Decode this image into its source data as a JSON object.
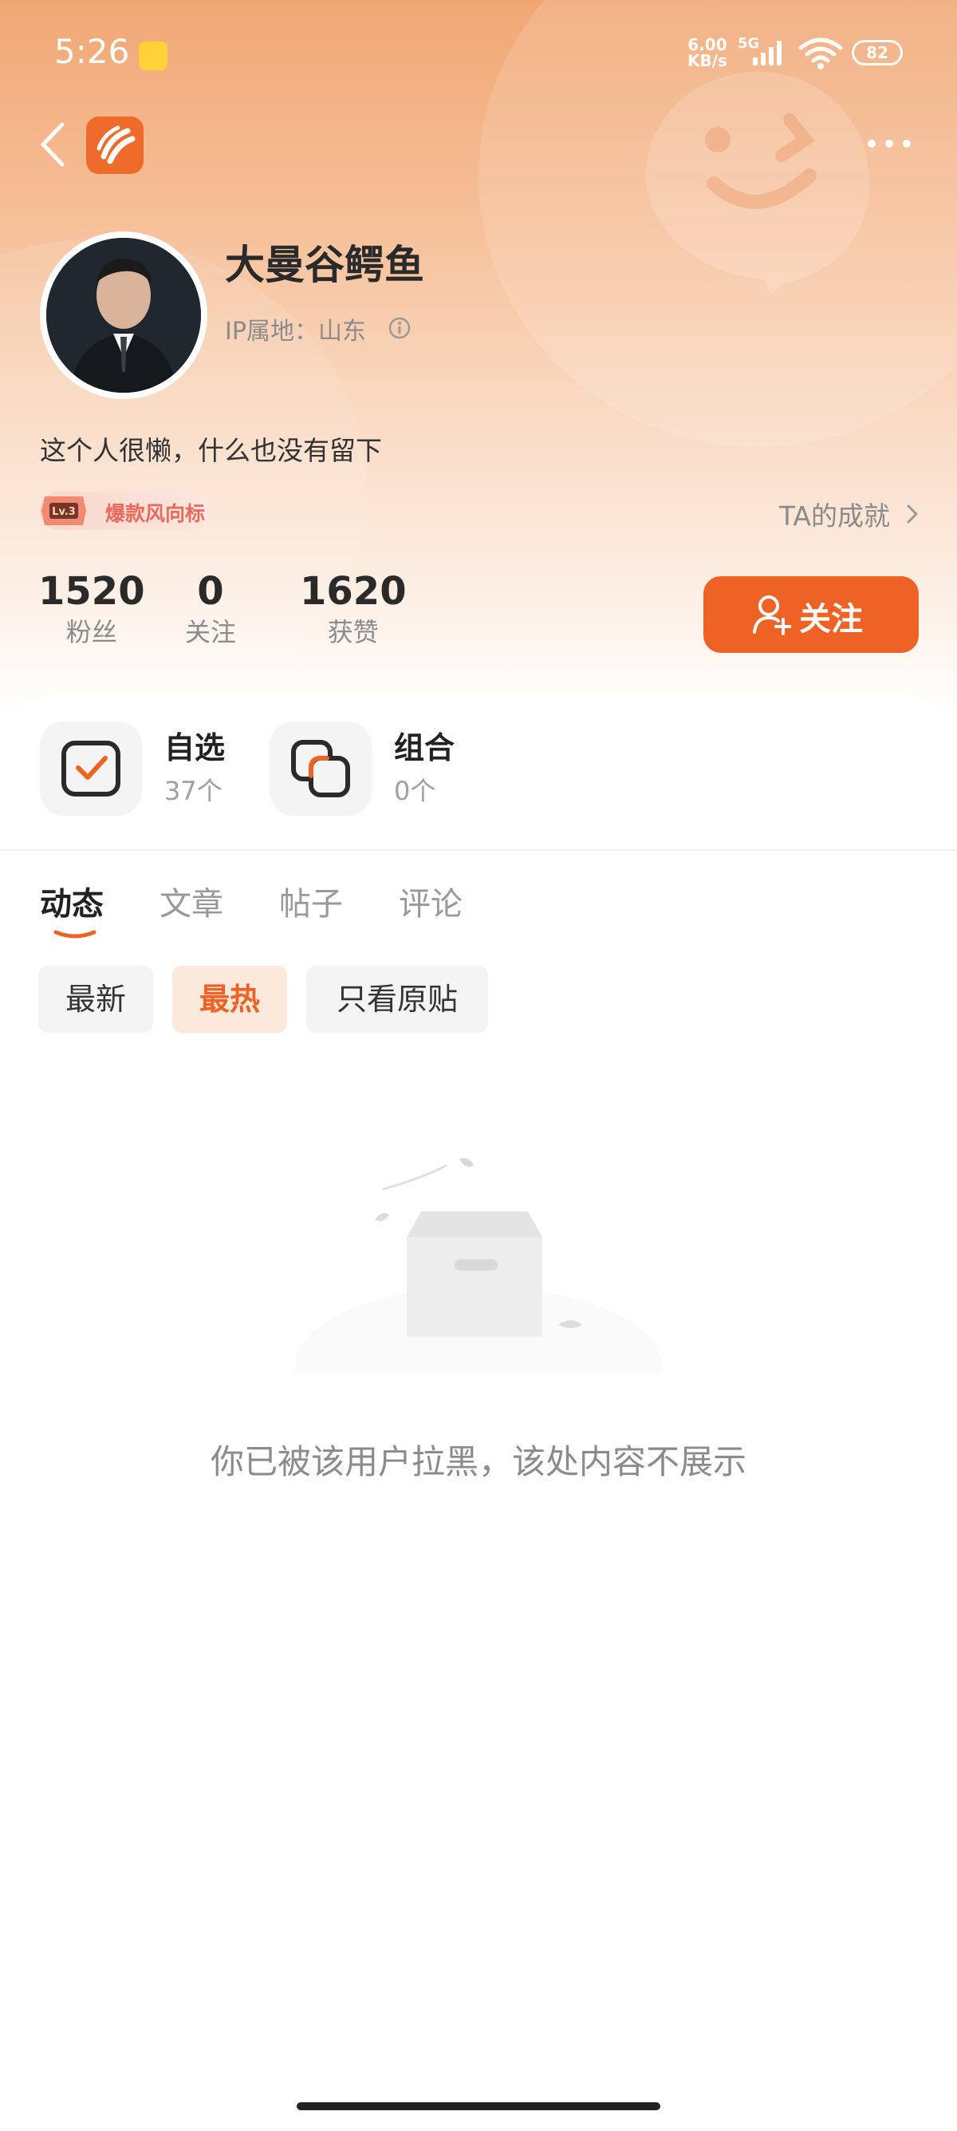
{
  "status_bar": {
    "time": "5:26",
    "net_speed_top": "6.00",
    "net_speed_bottom": "KB/s",
    "network_type": "5G",
    "battery": "82"
  },
  "header": {
    "back_icon": "chevron-left-icon",
    "app_icon": "app-logo-icon",
    "more_icon": "more-dots-icon"
  },
  "profile": {
    "name": "大曼谷鳄鱼",
    "ip_location": "IP属地：山东",
    "bio": "这个人很懒，什么也没有留下",
    "badge_text": "爆款风向标",
    "badge_level": "Lv.3",
    "achievements_link": "TA的成就"
  },
  "stats": [
    {
      "value": "1520",
      "label": "粉丝"
    },
    {
      "value": "0",
      "label": "关注"
    },
    {
      "value": "1620",
      "label": "获赞"
    }
  ],
  "follow_button": "关注",
  "quick_access": [
    {
      "title": "自选",
      "subtitle": "37个",
      "icon": "checkbox-icon"
    },
    {
      "title": "组合",
      "subtitle": "0个",
      "icon": "stack-icon"
    }
  ],
  "tabs": [
    "动态",
    "文章",
    "帖子",
    "评论"
  ],
  "active_tab": "动态",
  "filters": [
    "最新",
    "最热",
    "只看原贴"
  ],
  "active_filter": "最热",
  "empty_state": {
    "message": "你已被该用户拉黑，该处内容不展示",
    "icon": "empty-box-icon"
  },
  "colors": {
    "accent": "#ef6225",
    "hero_top": "#f1a774"
  }
}
